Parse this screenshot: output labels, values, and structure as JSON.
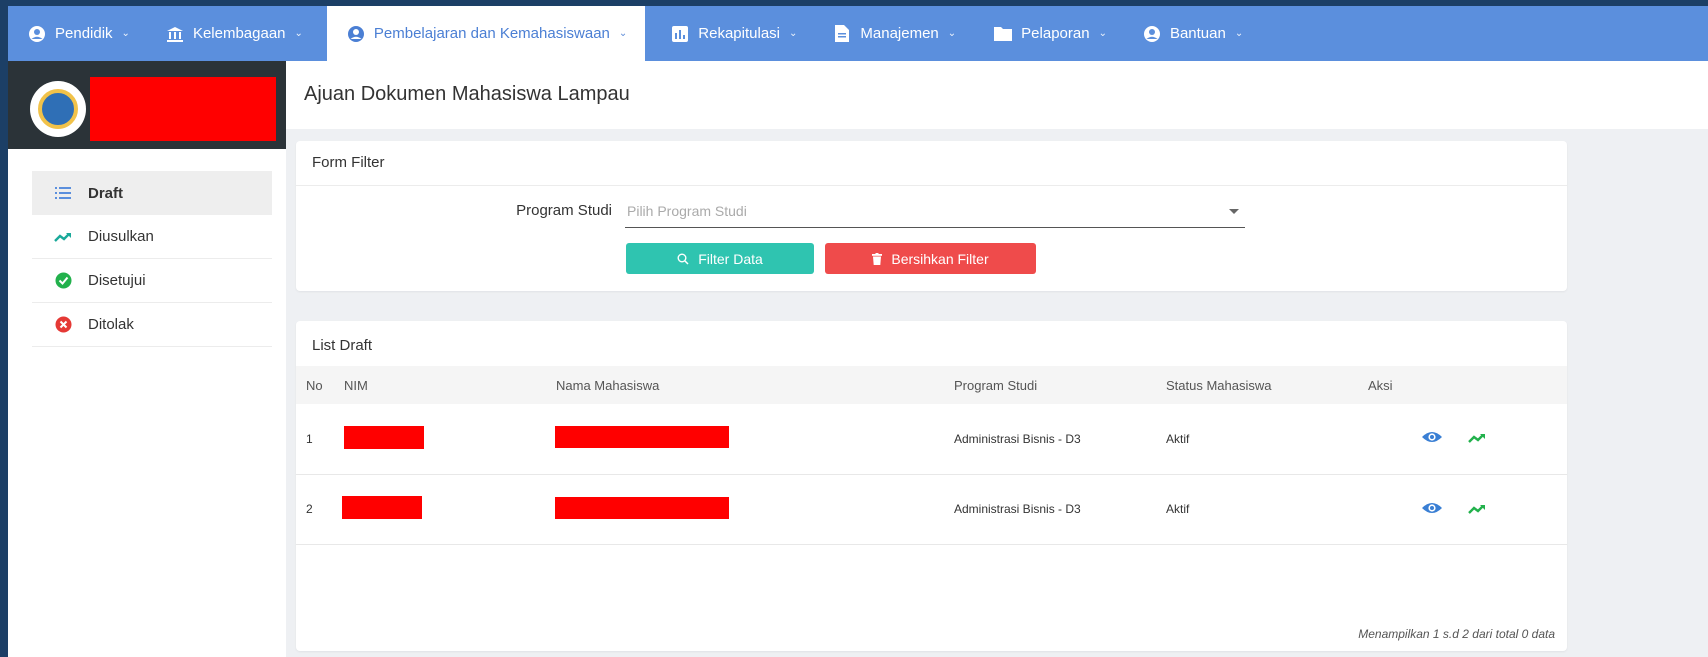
{
  "nav": {
    "items": [
      {
        "label": "Pendidik",
        "icon": "user-circle-icon"
      },
      {
        "label": "Kelembagaan",
        "icon": "institution-icon"
      },
      {
        "label": "Pembelajaran dan Kemahasiswaan",
        "icon": "user-circle-icon",
        "active": true
      },
      {
        "label": "Rekapitulasi",
        "icon": "bar-chart-icon"
      },
      {
        "label": "Manajemen",
        "icon": "document-icon"
      },
      {
        "label": "Pelaporan",
        "icon": "folder-icon"
      },
      {
        "label": "Bantuan",
        "icon": "user-circle-icon"
      }
    ]
  },
  "sidebar": {
    "items": [
      {
        "label": "Draft",
        "icon": "list-icon",
        "active": true
      },
      {
        "label": "Diusulkan",
        "icon": "trend-arrow-icon"
      },
      {
        "label": "Disetujui",
        "icon": "check-circle-icon"
      },
      {
        "label": "Ditolak",
        "icon": "x-circle-icon"
      }
    ]
  },
  "page": {
    "title": "Ajuan Dokumen Mahasiswa Lampau"
  },
  "filter": {
    "title": "Form Filter",
    "program_label": "Program Studi",
    "program_placeholder": "Pilih Program Studi",
    "filter_button": "Filter Data",
    "clear_button": "Bersihkan Filter"
  },
  "list": {
    "title": "List Draft",
    "columns": [
      "No",
      "NIM",
      "Nama Mahasiswa",
      "Program Studi",
      "Status Mahasiswa",
      "Aksi"
    ],
    "rows": [
      {
        "no": "1",
        "program": "Administrasi Bisnis - D3",
        "status": "Aktif"
      },
      {
        "no": "2",
        "program": "Administrasi Bisnis - D3",
        "status": "Aktif"
      }
    ],
    "footer": "Menampilkan 1 s.d 2 dari total 0 data"
  },
  "colors": {
    "nav_bg": "#5b8fdd",
    "active_nav_text": "#4b7fd4",
    "filter_button": "#2fc4b0",
    "clear_button": "#ef4b4b",
    "redaction": "#ff0000"
  }
}
